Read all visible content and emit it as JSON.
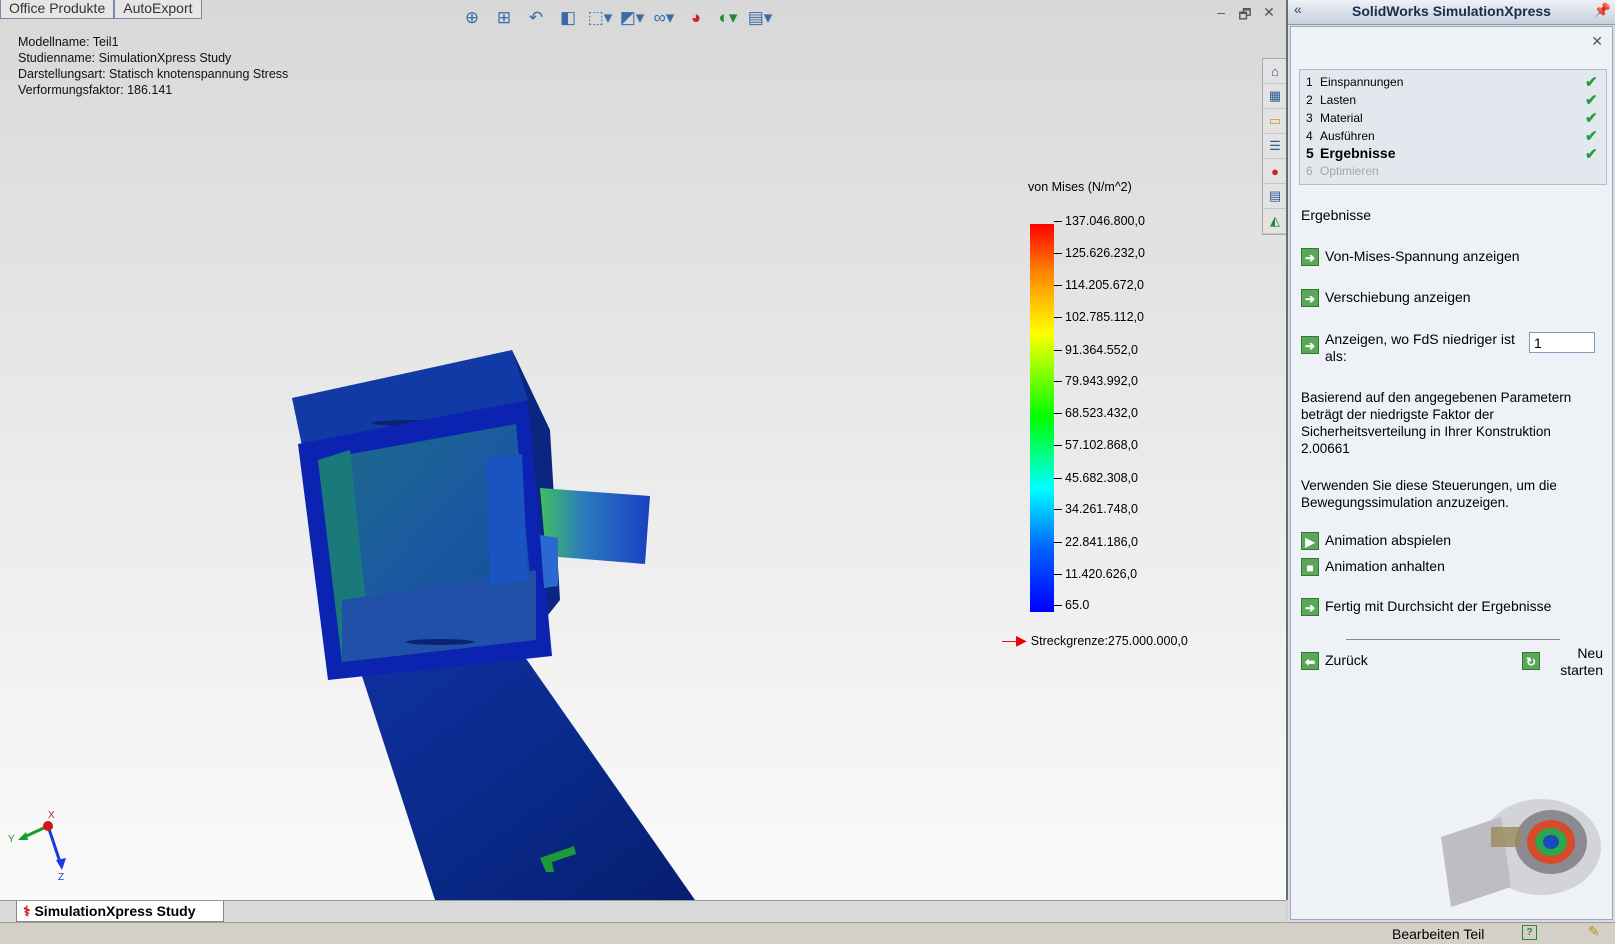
{
  "menu_tabs": [
    "Office Produkte",
    "AutoExport"
  ],
  "toolbar_icons": [
    "zoom-to-fit-icon",
    "zoom-area-icon",
    "previous-view-icon",
    "section-view-icon",
    "view-orientation-icon",
    "display-style-icon",
    "hide-show-icon",
    "appearance-icon",
    "scene-icon",
    "view-settings-icon"
  ],
  "window_controls": {
    "minimize": "–",
    "restore": "🗗",
    "close": "✕"
  },
  "info": {
    "line1": "Modellname: Teil1",
    "line2": "Studienname: SimulationXpress Study",
    "line3": "Darstellungsart: Statisch knotenspannung Stress",
    "line4": "Verformungsfaktor: 186.141"
  },
  "side_toolbar_icons": [
    "home-icon",
    "resources-icon",
    "file-explorer-icon",
    "view-palette-icon",
    "appearances-icon",
    "custom-properties-icon",
    "simulationxpress-icon"
  ],
  "legend": {
    "title": "von Mises (N/m^2)",
    "values": [
      "137.046.800,0",
      "125.626.232,0",
      "114.205.672,0",
      "102.785.112,0",
      "91.364.552,0",
      "79.943.992,0",
      "68.523.432,0",
      "57.102.868,0",
      "45.682.308,0",
      "34.261.748,0",
      "22.841.186,0",
      "11.420.626,0",
      "65.0"
    ],
    "yield_label": "Streckgrenze:275.000.000,0",
    "colors": [
      "#ff0000",
      "#ffff00",
      "#00ff00",
      "#00ffff",
      "#0000ff"
    ]
  },
  "triad": {
    "x": "X",
    "y": "Y",
    "z": "Z"
  },
  "study_tab": "SimulationXpress Study",
  "status": {
    "mode": "Bearbeiten Teil",
    "help": "?"
  },
  "panel": {
    "title": "SolidWorks SimulationXpress",
    "collapse": "«",
    "steps": [
      {
        "num": "1",
        "label": "Einspannungen",
        "done": true
      },
      {
        "num": "2",
        "label": "Lasten",
        "done": true
      },
      {
        "num": "3",
        "label": "Material",
        "done": true
      },
      {
        "num": "4",
        "label": "Ausführen",
        "done": true
      },
      {
        "num": "5",
        "label": "Ergebnisse",
        "done": true
      },
      {
        "num": "6",
        "label": "Optimieren",
        "done": false
      }
    ],
    "section_title": "Ergebnisse",
    "show_von_mises": "Von-Mises-Spannung anzeigen",
    "show_displacement": "Verschiebung anzeigen",
    "fos_label": "Anzeigen, wo FdS niedriger ist als:",
    "fos_value": "1",
    "result_text": "Basierend auf den angegebenen Parametern beträgt der niedrigste Faktor der Sicherheitsverteilung in Ihrer Konstruktion 2.00661",
    "animation_text": "Verwenden Sie diese Steuerungen, um die Bewegungssimulation anzuzeigen.",
    "play_animation": "Animation abspielen",
    "stop_animation": "Animation anhalten",
    "done_results": "Fertig mit Durchsicht der Ergebnisse",
    "back": "Zurück",
    "restart": "Neu starten"
  }
}
